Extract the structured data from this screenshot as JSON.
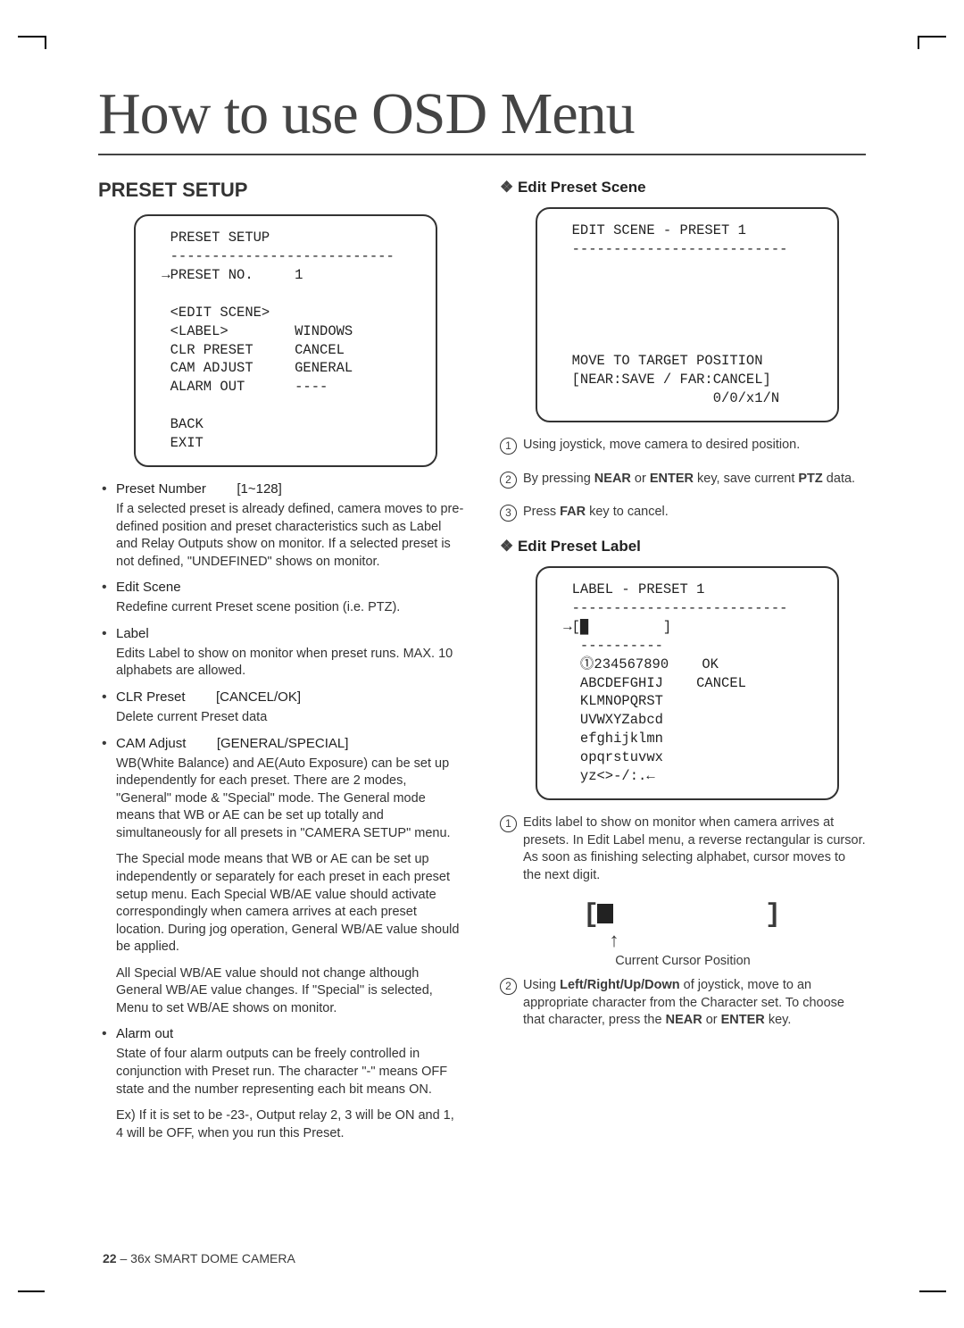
{
  "title": "How to use OSD Menu",
  "left": {
    "section": "PRESET SETUP",
    "screen": "  PRESET SETUP\n  ---------------------------\n →PRESET NO.     1\n\n  <EDIT SCENE>\n  <LABEL>        WINDOWS\n  CLR PRESET     CANCEL\n  CAM ADJUST     GENERAL\n  ALARM OUT      ----\n\n  BACK\n  EXIT",
    "items": {
      "preset_number": {
        "head": "Preset Number",
        "range": "[1~128]",
        "desc": "If a selected preset is already defined, camera moves to pre-defined position and preset characteristics such as Label and Relay Outputs show on monitor. If a selected preset is not defined, \"UNDEFINED\" shows on monitor."
      },
      "edit_scene": {
        "head": "Edit Scene",
        "desc": "Redefine current Preset scene position (i.e. PTZ)."
      },
      "label": {
        "head": "Label",
        "desc": "Edits Label to show on monitor when preset runs. MAX. 10 alphabets are allowed."
      },
      "clr_preset": {
        "head": "CLR Preset",
        "range": "[CANCEL/OK]",
        "desc": "Delete current Preset data"
      },
      "cam_adjust": {
        "head": "CAM Adjust",
        "range": "[GENERAL/SPECIAL]",
        "desc1": "WB(White Balance) and AE(Auto Exposure) can be set up independently for each preset. There are 2 modes, \"General\" mode & \"Special\" mode. The General mode means that WB or AE can be set up totally and simultaneously for all presets in \"CAMERA SETUP\" menu.",
        "desc2": "The Special mode means that WB or AE can be set up independently or separately for each preset in each preset setup menu. Each Special WB/AE value should activate correspondingly when camera arrives at each preset location. During jog operation, General WB/AE value should be applied.",
        "desc3": "All Special WB/AE value should not change although General WB/AE value changes. If \"Special'' is selected, Menu to set WB/AE shows on monitor."
      },
      "alarm_out": {
        "head": "Alarm out",
        "desc1": "State of four alarm outputs can be freely controlled in conjunction with Preset run. The character \"-\" means OFF state and the number representing each bit means ON.",
        "desc2": "Ex) If it is set to be -23-, Output relay 2, 3 will be ON and 1, 4 will be OFF, when you run this Preset."
      }
    }
  },
  "right": {
    "edit_scene": {
      "title": "Edit Preset Scene",
      "screen": "  EDIT SCENE - PRESET 1\n  --------------------------\n\n\n\n\n\n  MOVE TO TARGET POSITION\n  [NEAR:SAVE / FAR:CANCEL]\n                   0/0/x1/N",
      "step1": "Using joystick, move camera to desired position.",
      "step2a": "By pressing ",
      "step2_near": "NEAR",
      "step2b": " or ",
      "step2_enter": "ENTER",
      "step2c": " key, save current ",
      "step2_ptz": "PTZ",
      "step2d": " data.",
      "step3a": "Press ",
      "step3_far": "FAR",
      "step3b": " key to cancel."
    },
    "edit_label": {
      "title": "Edit Preset Label",
      "screen": "  LABEL - PRESET 1\n  --------------------------\n →[█         ]\n   ----------\n   ⓵234567890    OK\n   ABCDEFGHIJ    CANCEL\n   KLMNOPQRST\n   UVWXYZabcd\n   efghijklmn\n   opqrstuvwx\n   yz<>-/:.←",
      "step1": "Edits label to show on monitor when camera arrives at presets. In Edit Label menu, a reverse rectangular is cursor. As soon as finishing selecting alphabet, cursor moves to the next digit.",
      "cursor_caption": "Current Cursor Position",
      "step2a": "Using ",
      "step2_dir": "Left/Right/Up/Down",
      "step2b": " of joystick, move to an appropriate character from the Character set. To choose that character, press the ",
      "step2_near": "NEAR",
      "step2c": " or ",
      "step2_enter": "ENTER",
      "step2d": " key."
    }
  },
  "footer": {
    "page": "22",
    "sep": " – ",
    "product": "36x SMART DOME CAMERA"
  }
}
